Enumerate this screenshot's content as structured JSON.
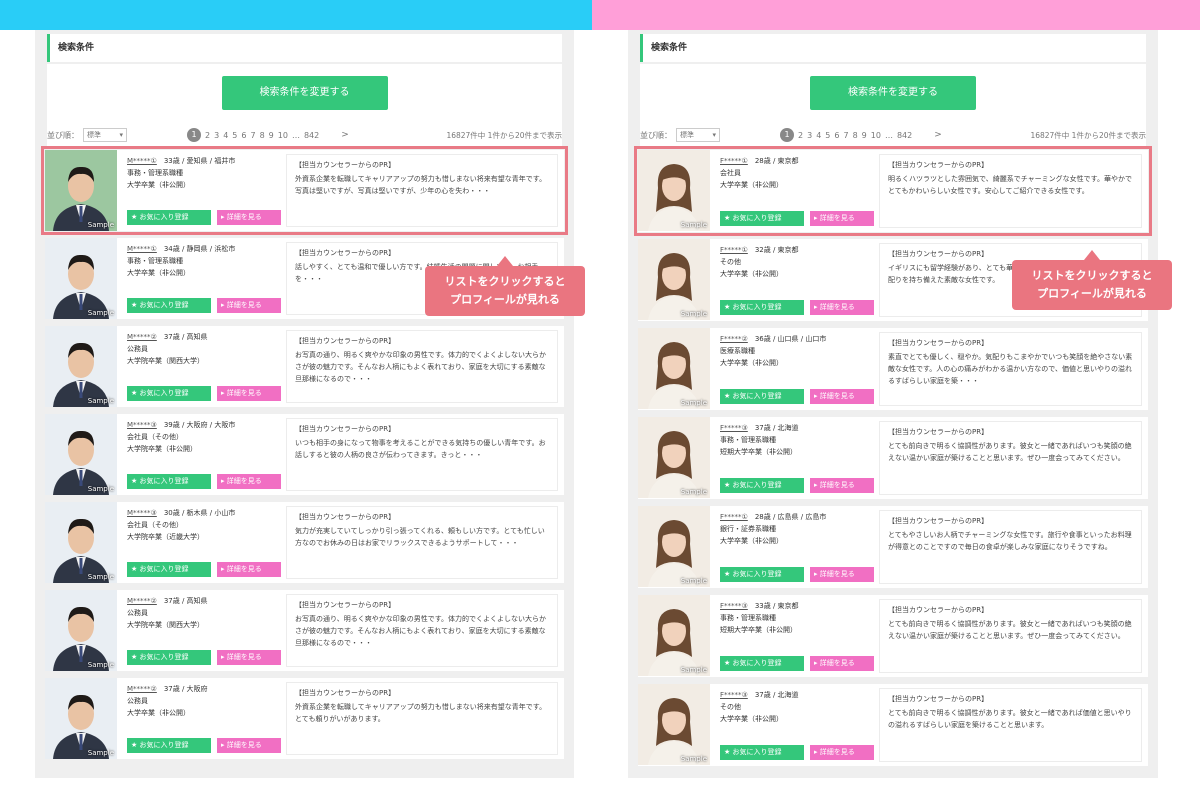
{
  "colors": {
    "green": "#34c77b",
    "pink": "#f16fc3",
    "highlight": "#e97a86",
    "male_bar": "#29cdf7",
    "female_bar": "#ff9fd8"
  },
  "male": {
    "condition_title": "検索条件",
    "change_button": "検索条件を変更する",
    "sort_label": "並び順：",
    "sort_value": "標準",
    "pages": [
      "1",
      "2",
      "3",
      "4",
      "5",
      "6",
      "7",
      "8",
      "9",
      "10",
      "…",
      "842"
    ],
    "next": ">",
    "count": "16827件中 1件から20件まで表示",
    "callout": [
      "リストをクリックすると",
      "プロフィールが見れる"
    ],
    "profiles": [
      {
        "name": "M*****①",
        "age_area": "33歳 / 愛知県 / 福井市",
        "job": "事務・管理系職種",
        "edu": "大学卒業（非公開）",
        "pr_title": "【担当カウンセラーからのPR】",
        "pr": "外資系企業を転職してキャリアアップの努力も惜しまない将来有望な青年です。写真は堅いですが、写真は堅いですが、少年の心を失わ・・・"
      },
      {
        "name": "M*****①",
        "age_area": "34歳 / 静岡県 / 浜松市",
        "job": "事務・管理系職種",
        "edu": "大学卒業（非公開）",
        "pr_title": "【担当カウンセラーからのPR】",
        "pr": "話しやすく、とても温和で優しい方です。結婚生活の問題に関しては、お相手を・・・"
      },
      {
        "name": "M*****②",
        "age_area": "37歳 / 高知県",
        "job": "公務員",
        "edu": "大学院卒業（関西大学）",
        "pr_title": "【担当カウンセラーからのPR】",
        "pr": "お写真の通り、明るく爽やかな印象の男性です。体力的でくよくよしない大らかさが彼の魅力です。そんなお人柄にもよく表れており、家庭を大切にする素敵な旦那様になるので・・・"
      },
      {
        "name": "M*****③",
        "age_area": "39歳 / 大阪府 / 大阪市",
        "job": "会社員（その他）",
        "edu": "大学院卒業（非公開）",
        "pr_title": "【担当カウンセラーからのPR】",
        "pr": "いつも相手の身になって物事を考えることができる気持ちの優しい青年です。お話しすると彼の人柄の良さが伝わってきます。きっと・・・"
      },
      {
        "name": "M*****③",
        "age_area": "30歳 / 栃木県 / 小山市",
        "job": "会社員（その他）",
        "edu": "大学院卒業（近畿大学）",
        "pr_title": "【担当カウンセラーからのPR】",
        "pr": "気力が充実していてしっかり引っ張ってくれる、頼もしい方です。とても忙しい方なのでお休みの日はお家でリラックスできるようサポートして・・・"
      },
      {
        "name": "M*****②",
        "age_area": "37歳 / 高知県",
        "job": "公務員",
        "edu": "大学院卒業（関西大学）",
        "pr_title": "【担当カウンセラーからのPR】",
        "pr": "お写真の通り、明るく爽やかな印象の男性です。体力的でくよくよしない大らかさが彼の魅力です。そんなお人柄にもよく表れており、家庭を大切にする素敵な旦那様になるので・・・"
      },
      {
        "name": "M*****②",
        "age_area": "37歳 / 大阪府",
        "job": "公務員",
        "edu": "大学卒業（非公開）",
        "pr_title": "【担当カウンセラーからのPR】",
        "pr": "外資系企業を転職してキャリアアップの努力も惜しまない将来有望な青年です。とても頼りがいがあります。"
      }
    ]
  },
  "female": {
    "condition_title": "検索条件",
    "change_button": "検索条件を変更する",
    "sort_label": "並び順：",
    "sort_value": "標準",
    "pages": [
      "1",
      "2",
      "3",
      "4",
      "5",
      "6",
      "7",
      "8",
      "9",
      "10",
      "…",
      "842"
    ],
    "next": ">",
    "count": "16827件中 1件から20件まで表示",
    "callout": [
      "リストをクリックすると",
      "プロフィールが見れる"
    ],
    "profiles": [
      {
        "name": "F*****①",
        "age_area": "28歳 / 東京都",
        "job": "会社員",
        "edu": "大学卒業（非公開）",
        "pr_title": "【担当カウンセラーからのPR】",
        "pr": "明るくハツラツとした雰囲気で、綺麗系でチャーミングな女性です。華やかでとてもかわいらしい女性です。安心してご紹介できる女性です。"
      },
      {
        "name": "F*****①",
        "age_area": "32歳 / 東京都",
        "job": "その他",
        "edu": "大学卒業（非公開）",
        "pr_title": "【担当カウンセラーからのPR】",
        "pr": "イギリスにも留学経験があり、とても華やかな方です。素朴かしさや人への気配りを持ち備えた素敵な女性です。"
      },
      {
        "name": "F*****②",
        "age_area": "36歳 / 山口県 / 山口市",
        "job": "医療系職種",
        "edu": "大学卒業（非公開）",
        "pr_title": "【担当カウンセラーからのPR】",
        "pr": "素直でとても優しく、穏やか。気配りもこまやかでいつも笑顔を絶やさない素敵な女性です。人の心の痛みがわかる温かい方なので、価値と思いやりの溢れるすばらしい家庭を築・・・"
      },
      {
        "name": "F*****③",
        "age_area": "37歳 / 北海道",
        "job": "事務・管理系職種",
        "edu": "短期大学卒業（非公開）",
        "pr_title": "【担当カウンセラーからのPR】",
        "pr": "とても前向きで明るく協調性があります。彼女と一緒であればいつも笑顔の絶えない温かい家庭が築けることと思います。ぜひ一度会ってみてください。"
      },
      {
        "name": "F*****①",
        "age_area": "28歳 / 広島県 / 広島市",
        "job": "銀行・証券系職種",
        "edu": "大学卒業（非公開）",
        "pr_title": "【担当カウンセラーからのPR】",
        "pr": "とてもやさしいお人柄でチャーミングな女性です。旅行や食事といったお料理が得意とのことですので毎日の食卓が楽しみな家庭になりそうですね。"
      },
      {
        "name": "F*****③",
        "age_area": "33歳 / 東京都",
        "job": "事務・管理系職種",
        "edu": "短期大学卒業（非公開）",
        "pr_title": "【担当カウンセラーからのPR】",
        "pr": "とても前向きで明るく協調性があります。彼女と一緒であればいつも笑顔の絶えない温かい家庭が築けることと思います。ぜひ一度会ってみてください。"
      },
      {
        "name": "F*****③",
        "age_area": "37歳 / 北海道",
        "job": "その他",
        "edu": "大学卒業（非公開）",
        "pr_title": "【担当カウンセラーからのPR】",
        "pr": "とても前向きで明るく協調性があります。彼女と一緒であれば価値と思いやりの溢れるすばらしい家庭を築けることと思います。"
      }
    ]
  },
  "common": {
    "fav_label": "お気に入り登録",
    "detail_label": "詳細を見る",
    "sample_label": "Sample"
  }
}
